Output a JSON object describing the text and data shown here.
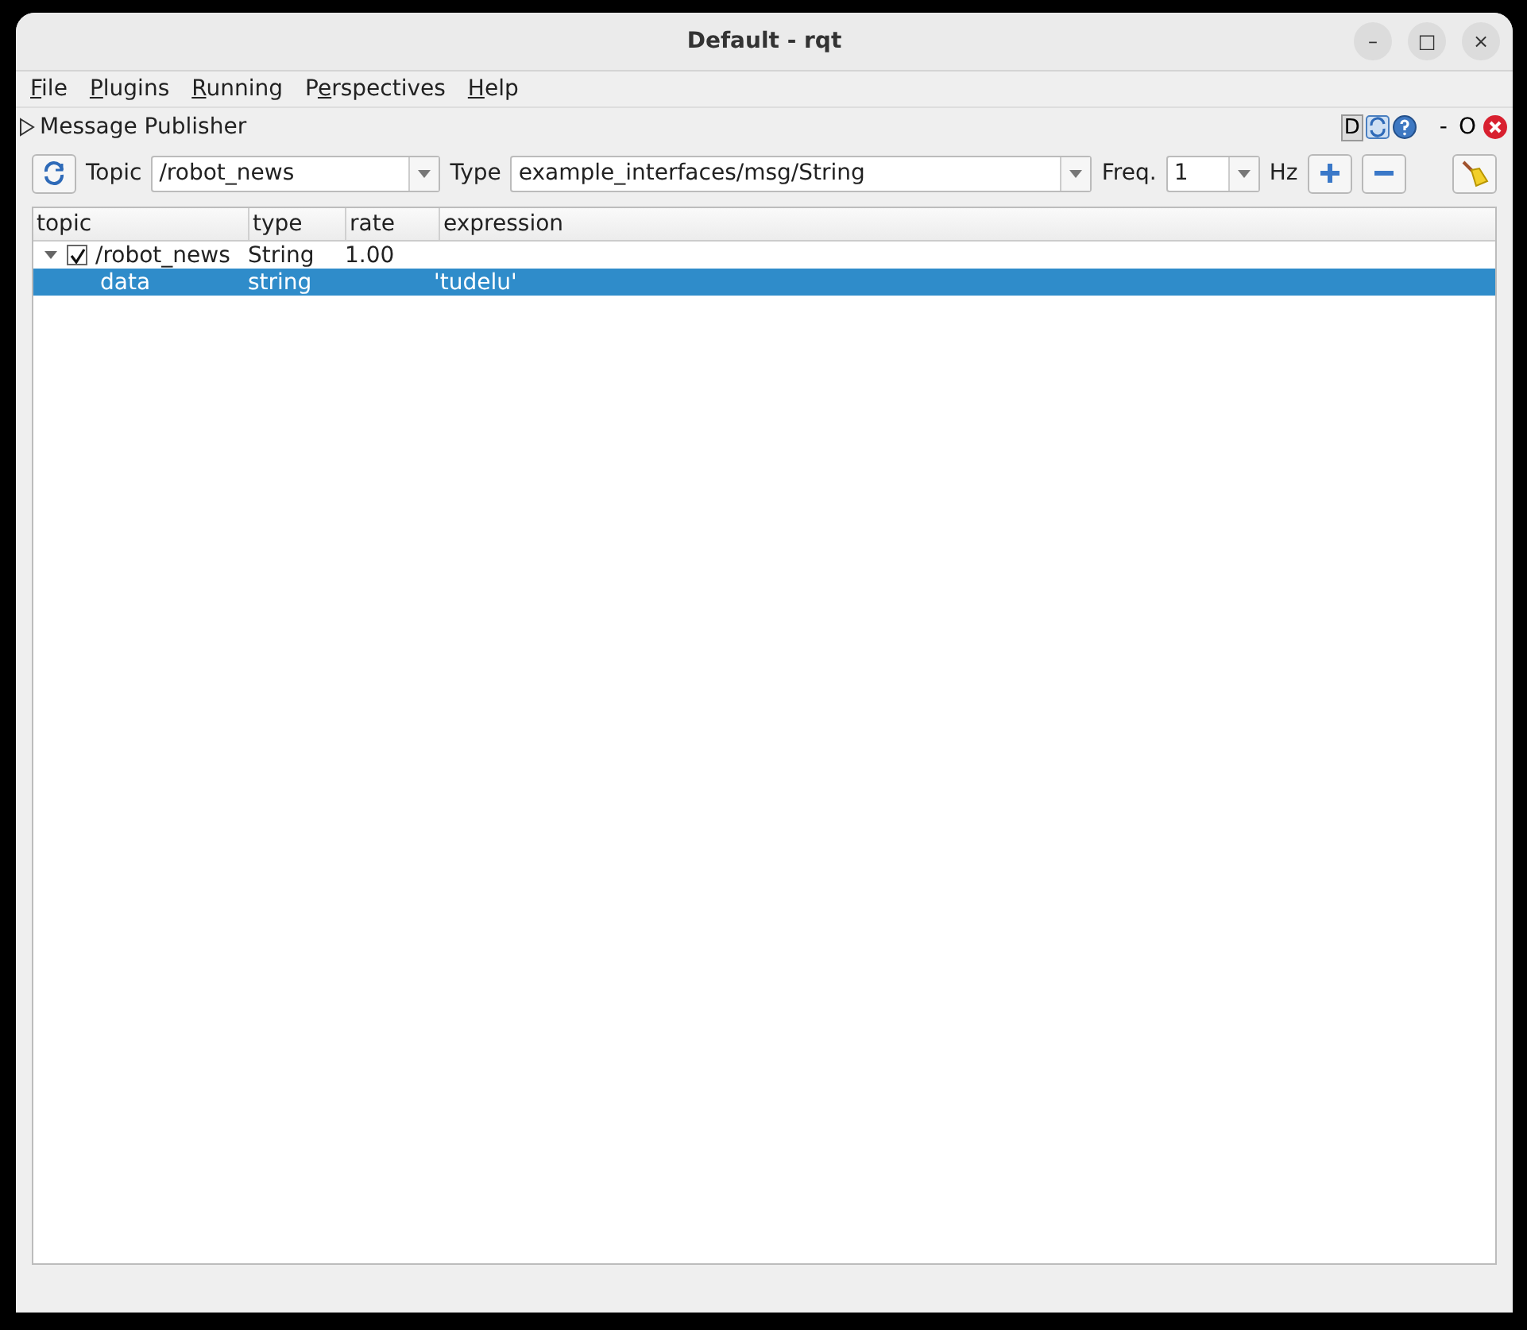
{
  "window": {
    "title": "Default - rqt",
    "controls": [
      "–",
      "□",
      "×"
    ]
  },
  "menu": [
    {
      "key": "F",
      "after": "ile"
    },
    {
      "key": "P",
      "after": "lugins"
    },
    {
      "key": "R",
      "after": "unning"
    },
    {
      "before": "P",
      "key": "e",
      "after": "rspectives"
    },
    {
      "key": "H",
      "after": "elp"
    }
  ],
  "plugin": {
    "title": "Message Publisher",
    "d_label": "D",
    "minimize": "-",
    "float": "O"
  },
  "toolbar": {
    "topic_label": "Topic",
    "topic": "/robot_news",
    "type_label": "Type",
    "type": "example_interfaces/msg/String",
    "freq_label": "Freq.",
    "freq": "1",
    "hz_label": "Hz"
  },
  "tree": {
    "columns": [
      "topic",
      "type",
      "rate",
      "expression"
    ],
    "rows": [
      {
        "topic": "/robot_news",
        "type": "String",
        "rate": "1.00",
        "checked": true,
        "expanded": true,
        "selected": false,
        "children": [
          {
            "topic": "data",
            "type": "string",
            "expression": "'tudelu'",
            "selected": true
          }
        ]
      }
    ]
  }
}
